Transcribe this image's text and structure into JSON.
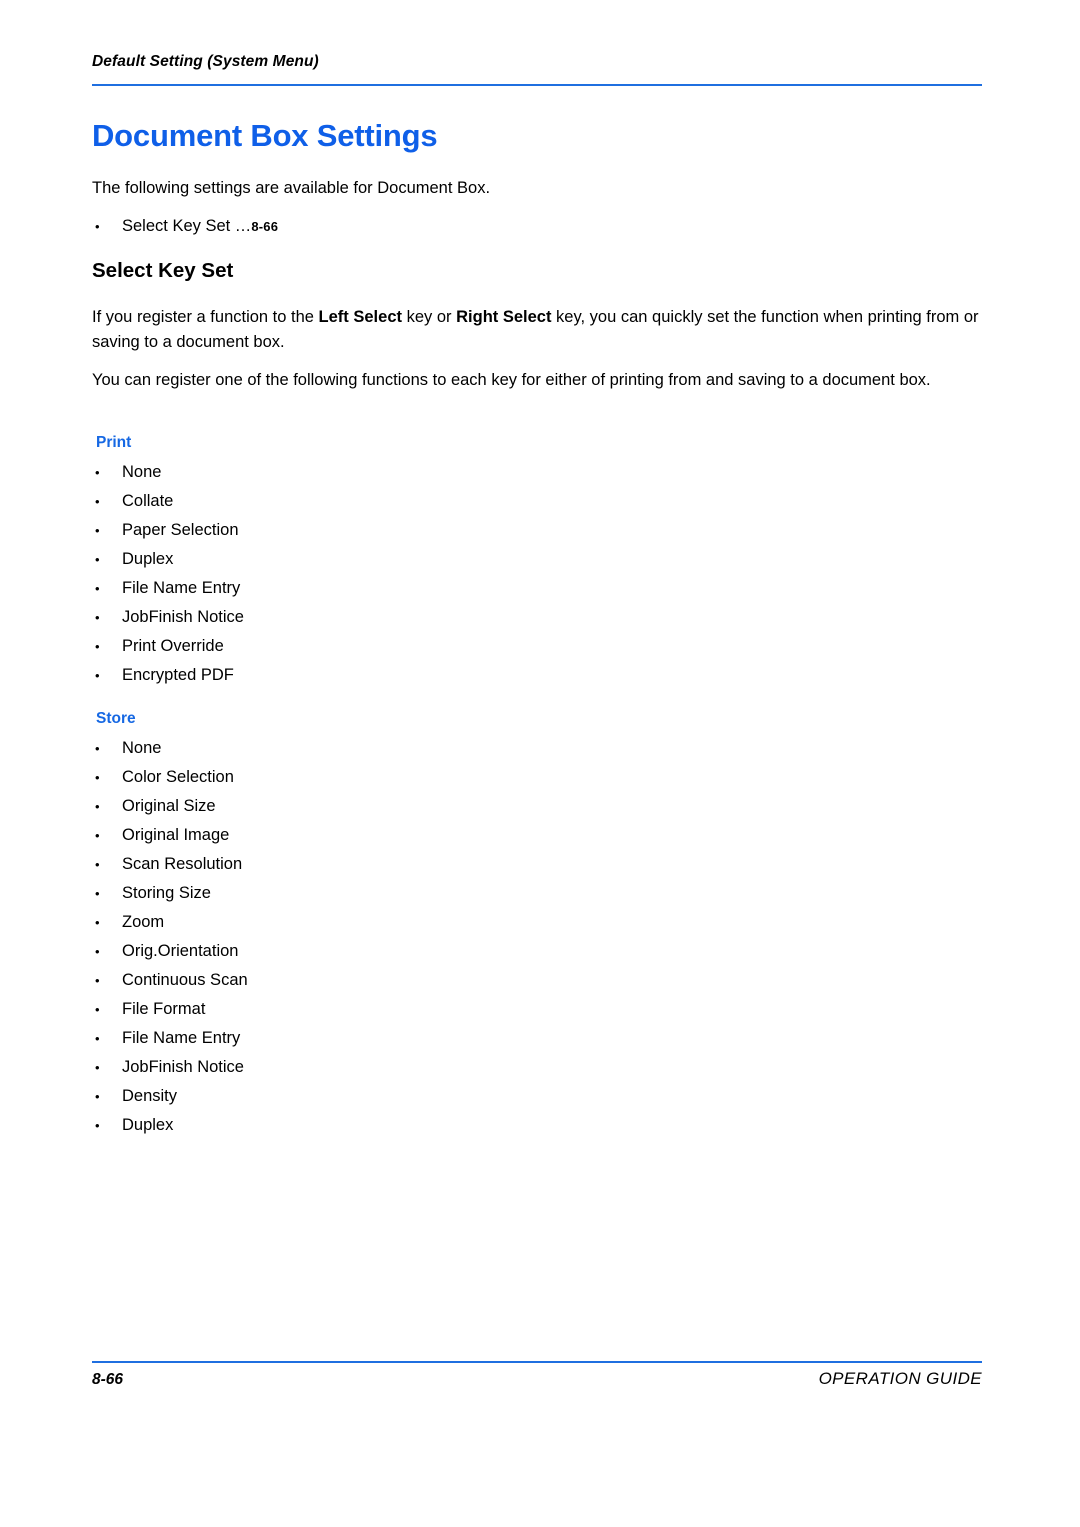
{
  "header": {
    "running_title": "Default Setting (System Menu)",
    "rule_color": "#1f6fe0"
  },
  "title": {
    "text": "Document Box Settings",
    "color": "#0f5fe8"
  },
  "intro": {
    "paragraph": "The following settings are available for Document Box.",
    "toc": [
      {
        "label": "Select Key Set …",
        "page_ref": "8-66"
      }
    ]
  },
  "section": {
    "heading": "Select Key Set",
    "paragraph_1_pre": "If you register a function to the ",
    "paragraph_1_bold_1": "Left Select",
    "paragraph_1_mid": " key or ",
    "paragraph_1_bold_2": "Right Select",
    "paragraph_1_post": " key, you can quickly set the function when printing from or saving to a document box.",
    "paragraph_2": "You can register one of the following functions to each key for either of printing from and saving to a document box."
  },
  "groups": [
    {
      "label": "Print",
      "label_color": "#1668e3",
      "items": [
        "None",
        "Collate",
        "Paper Selection",
        "Duplex",
        "File Name Entry",
        "JobFinish Notice",
        "Print Override",
        "Encrypted PDF"
      ]
    },
    {
      "label": "Store",
      "label_color": "#1668e3",
      "items": [
        "None",
        "Color Selection",
        "Original Size",
        "Original Image",
        "Scan Resolution",
        "Storing Size",
        "Zoom",
        "Orig.Orientation",
        "Continuous Scan",
        "File Format",
        "File Name Entry",
        "JobFinish Notice",
        "Density",
        "Duplex"
      ]
    }
  ],
  "footer": {
    "page_number": "8-66",
    "guide_label": "OPERATION GUIDE",
    "rule_color": "#1f6fe0"
  }
}
